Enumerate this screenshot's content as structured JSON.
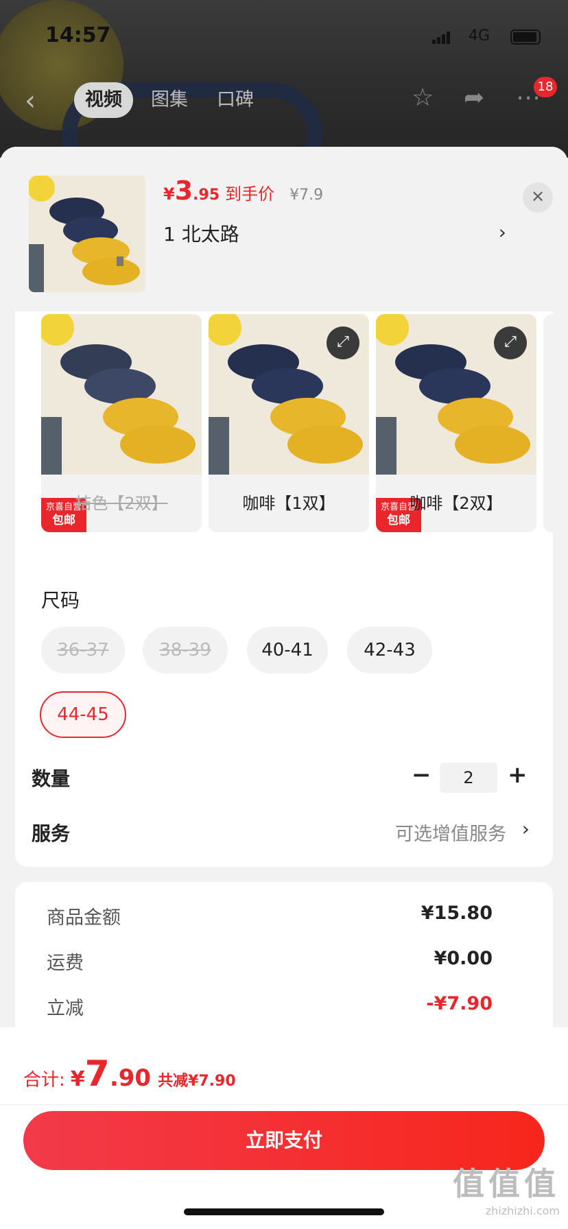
{
  "status_bar": {
    "time": "14:57",
    "network": "4G"
  },
  "nav": {
    "tabs": [
      {
        "label": "视频",
        "active": true
      },
      {
        "label": "图集",
        "active": false
      },
      {
        "label": "口碑",
        "active": false
      }
    ],
    "icons": [
      "back-icon",
      "star-icon",
      "share-icon",
      "more-icon"
    ],
    "more_badge": "18"
  },
  "product": {
    "price_currency": "¥",
    "price_int": "3",
    "price_dec": ".95",
    "price_tag": "到手价",
    "original_price": "¥7.9",
    "address": "1 北太路"
  },
  "variants": [
    {
      "label": "桔色【2双】",
      "disabled": true,
      "jd_tag": true
    },
    {
      "label": "咖啡【1双】",
      "disabled": false,
      "jd_tag": false
    },
    {
      "label": "咖啡【2双】",
      "disabled": false,
      "jd_tag": true
    }
  ],
  "jd_tag": {
    "top": "京喜自营",
    "bottom": "包邮"
  },
  "size": {
    "title": "尺码",
    "options": [
      {
        "label": "36-37",
        "state": "disabled"
      },
      {
        "label": "38-39",
        "state": "disabled"
      },
      {
        "label": "40-41",
        "state": "normal"
      },
      {
        "label": "42-43",
        "state": "normal"
      },
      {
        "label": "44-45",
        "state": "selected"
      }
    ]
  },
  "quantity": {
    "label": "数量",
    "value": "2",
    "minus": "−",
    "plus": "+"
  },
  "service": {
    "label": "服务",
    "value": "可选增值服务"
  },
  "fees": [
    {
      "label": "商品金额",
      "value": "¥15.80",
      "highlight": false
    },
    {
      "label": "运费",
      "value": "¥0.00",
      "highlight": false
    },
    {
      "label": "立减",
      "value": "-¥7.90",
      "highlight": true
    }
  ],
  "total": {
    "label": "合计:",
    "currency": "¥",
    "int": "7",
    "dec": ".90",
    "saving": "共减¥7.90"
  },
  "pay_button": "立即支付",
  "watermark": {
    "logo": "值值值",
    "url": "zhizhizhi.com"
  },
  "colors": {
    "accent": "#e8262c",
    "background": "#f2f2f2",
    "navy": "#25304f",
    "yellow": "#e8b62a"
  }
}
